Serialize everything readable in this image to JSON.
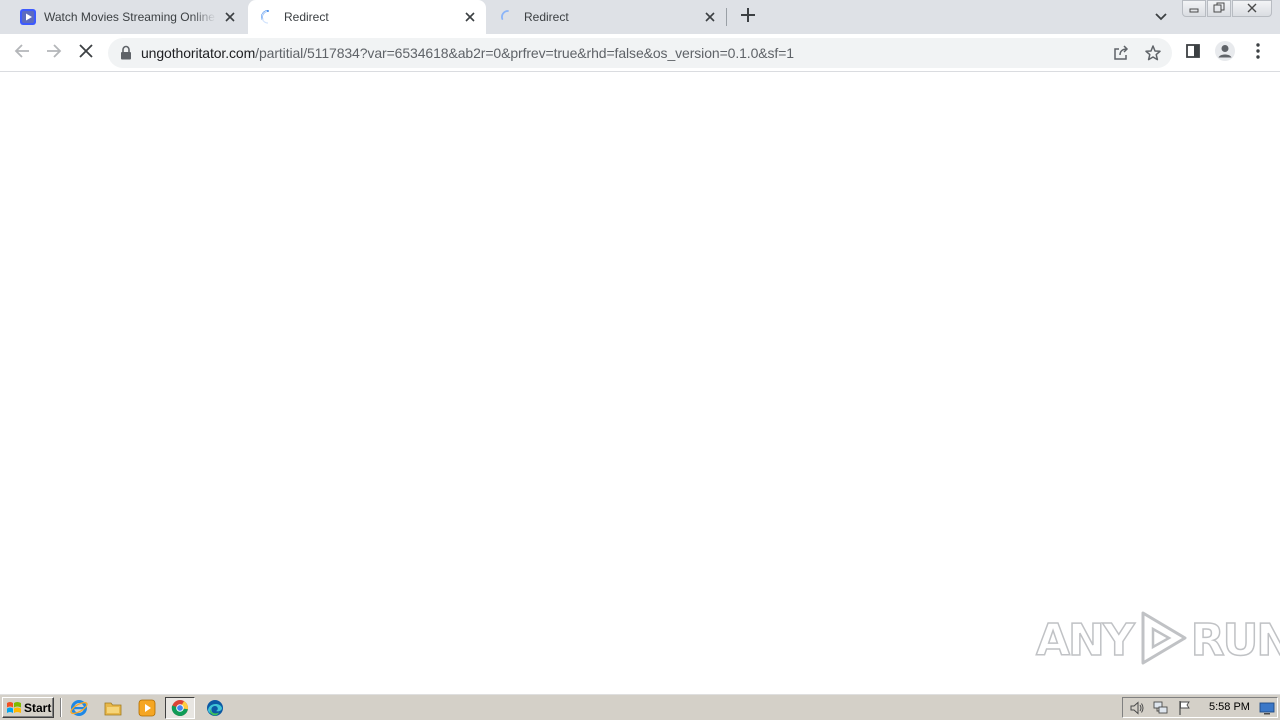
{
  "browser": {
    "tabs": [
      {
        "title": "Watch Movies Streaming Online Free",
        "icon": "video-play-favicon",
        "state": "loaded",
        "active": false
      },
      {
        "title": "Redirect",
        "icon": "loading-spinner",
        "state": "loading",
        "active": true
      },
      {
        "title": "Redirect",
        "icon": "loading-spinner",
        "state": "loading",
        "active": false
      }
    ],
    "new_tab_icon": "plus-icon",
    "tab_search_icon": "chevron-down-icon",
    "window_controls": [
      "minimize",
      "restore",
      "close"
    ]
  },
  "toolbar": {
    "back_icon": "arrow-left-icon",
    "forward_icon": "arrow-right-icon",
    "stop_icon": "stop-x-icon",
    "url_host": "ungothoritator.com",
    "url_path": "/partitial/5117834?var=6534618&ab2r=0&prfrev=true&rhd=false&os_version=0.1.0&sf=1",
    "secure_icon": "lock-icon",
    "share_icon": "share-icon",
    "bookmark_icon": "star-icon",
    "side_panel_icon": "side-panel-icon",
    "profile_icon": "profile-icon",
    "menu_icon": "more-vert-icon"
  },
  "watermark": {
    "text_left": "ANY",
    "text_right": "RUN"
  },
  "taskbar": {
    "start_label": "Start",
    "quick_launch": [
      "internet-explorer-icon",
      "folder-icon",
      "media-player-icon",
      "chrome-icon",
      "edge-icon"
    ],
    "tray_icons": [
      "volume-icon",
      "network-icon",
      "flag-icon",
      "monitor-icon"
    ],
    "clock": "5:58 PM"
  },
  "colors": {
    "tabstrip": "#dee1e6",
    "omnibox": "#f1f3f4",
    "taskbar": "#d4d0c8",
    "spinner": "#1a73e8"
  }
}
